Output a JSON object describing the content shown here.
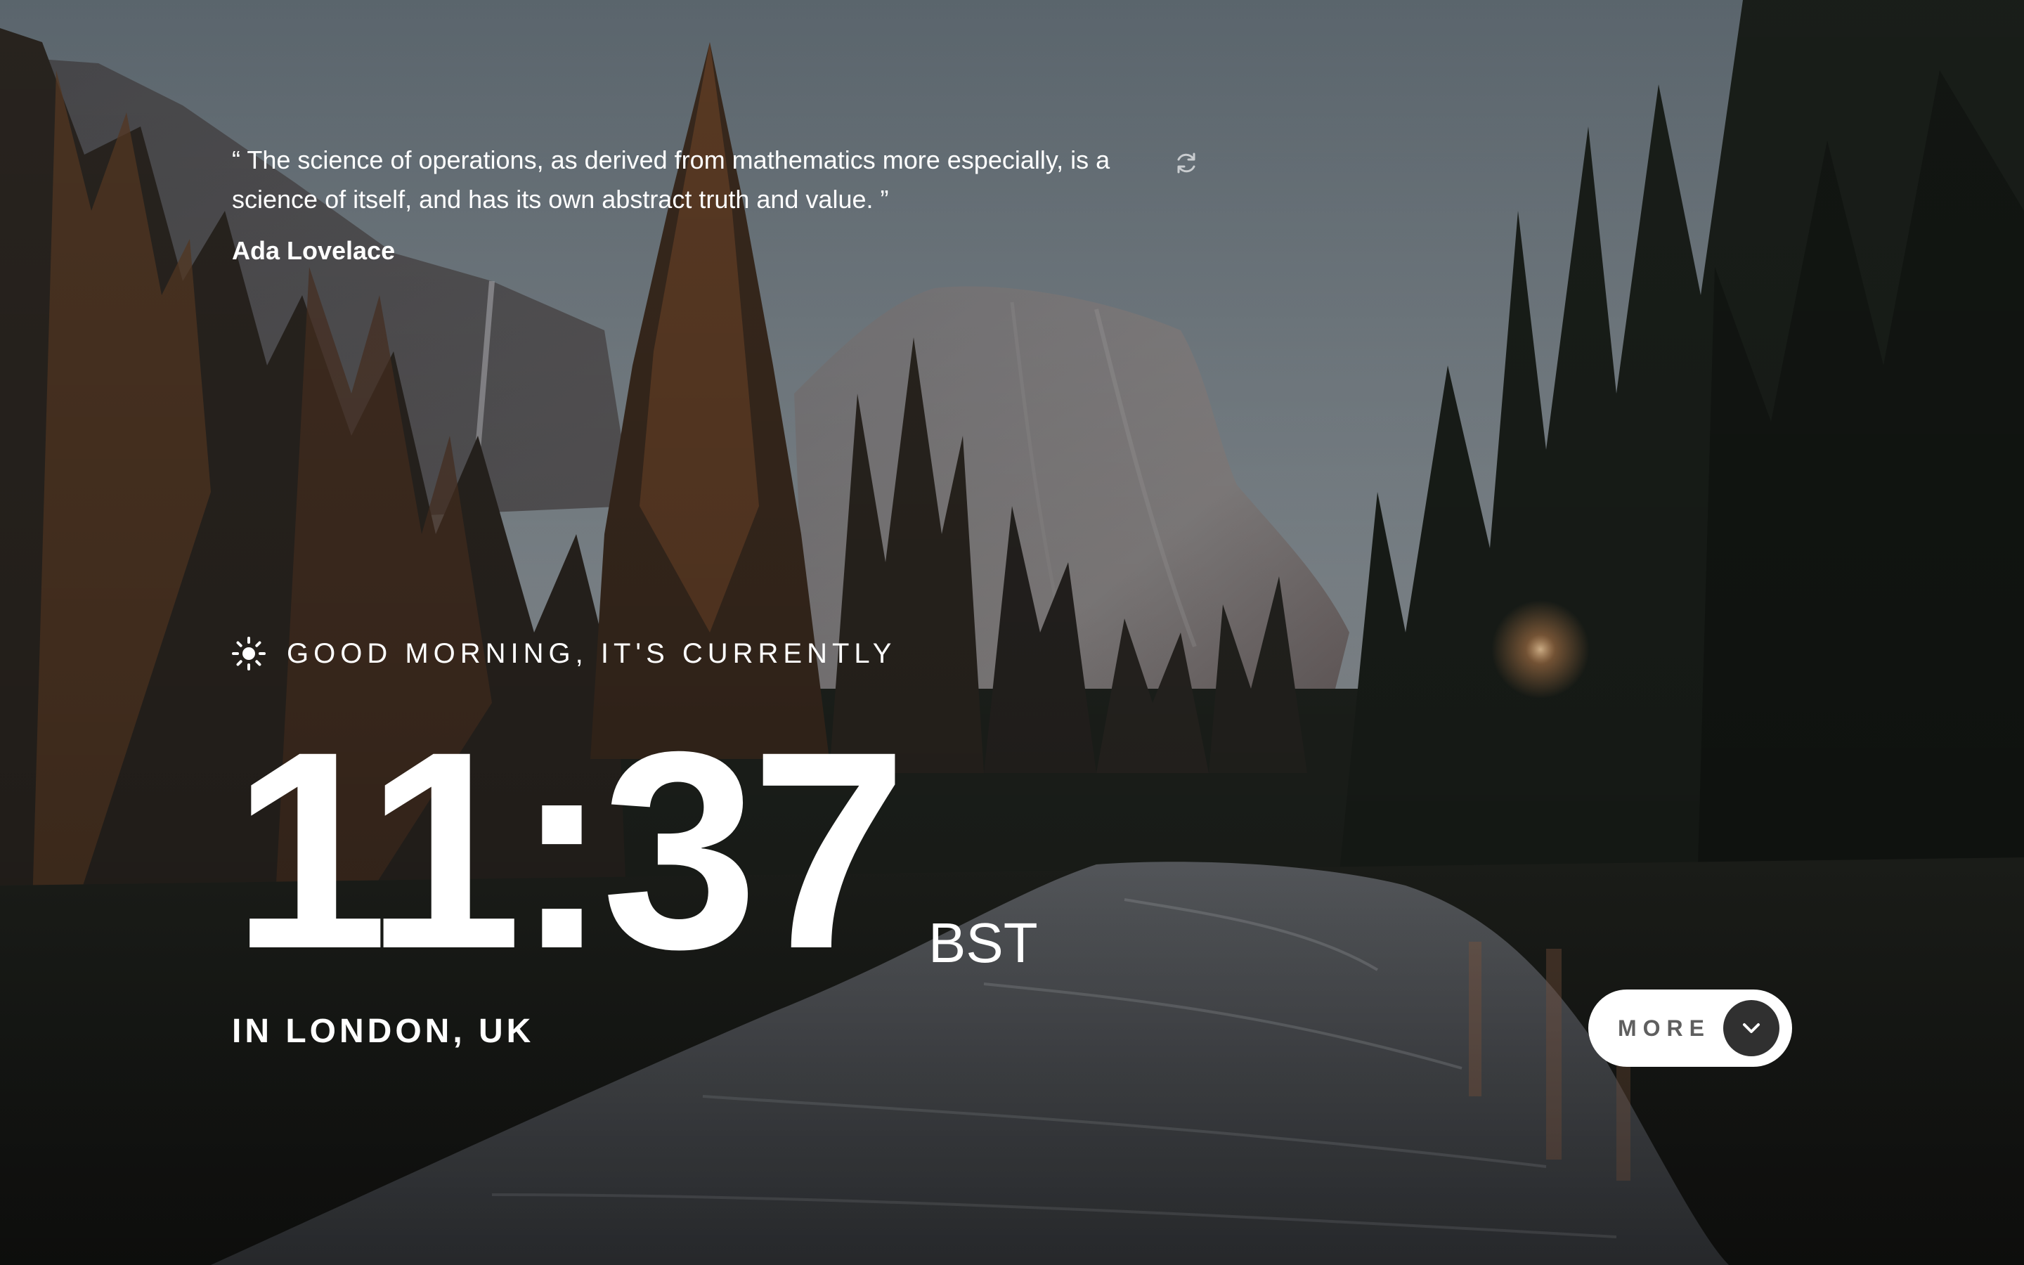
{
  "quote": {
    "text": "“ The science of operations, as derived from mathematics more especially, is a science of itself, and has its own abstract truth and value. ”",
    "author": "Ada Lovelace",
    "refresh_icon": "refresh-icon"
  },
  "greeting": {
    "icon": "sun-icon",
    "text": "GOOD MORNING, IT'S CURRENTLY"
  },
  "clock": {
    "time": "11:37",
    "timezone": "BST"
  },
  "location": {
    "text": "IN LONDON, UK"
  },
  "more_button": {
    "label": "MORE",
    "icon": "chevron-down-icon"
  },
  "colors": {
    "text": "#ffffff",
    "button_bg": "#ffffff",
    "button_label": "#5f5f5f",
    "chevron_bg": "#303030"
  }
}
